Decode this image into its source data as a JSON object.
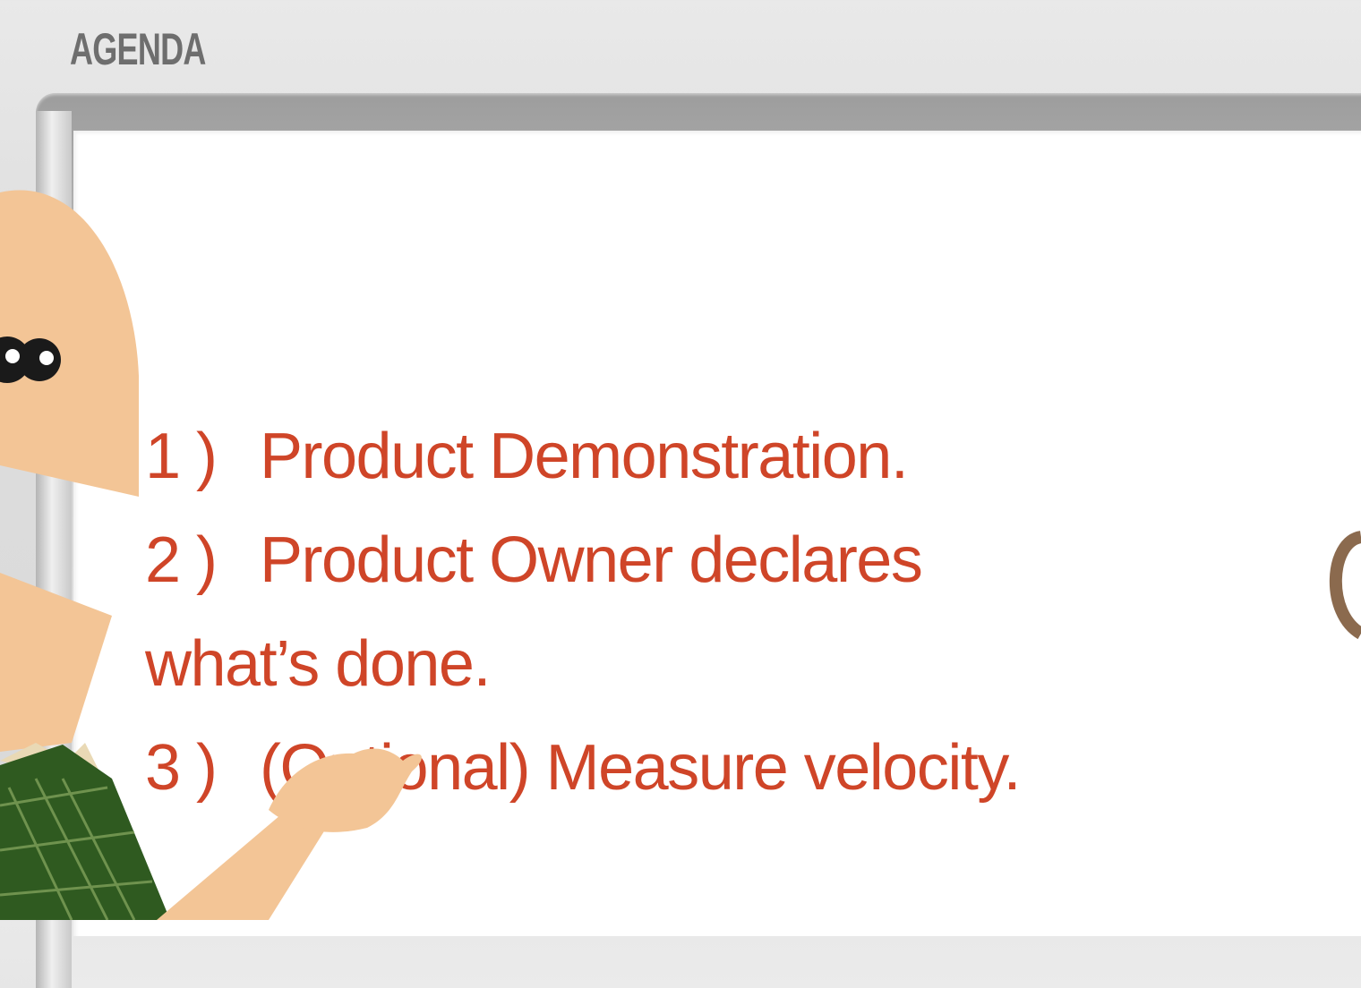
{
  "slide": {
    "header": "AGENDA",
    "items": [
      {
        "number": "1 )",
        "text": "Product Demonstration."
      },
      {
        "number": "2 )",
        "text": "Product Owner declares"
      },
      {
        "number": "",
        "text": "what’s done."
      },
      {
        "number": "3 )",
        "text": "(Optional) Measure velocity."
      }
    ]
  },
  "colors": {
    "accent_text": "#cf4528",
    "header_text": "#6e6e6e",
    "skin": "#f3c596",
    "shirt": "#2f5a20"
  },
  "icons": [
    "presenter-character-illustration"
  ]
}
